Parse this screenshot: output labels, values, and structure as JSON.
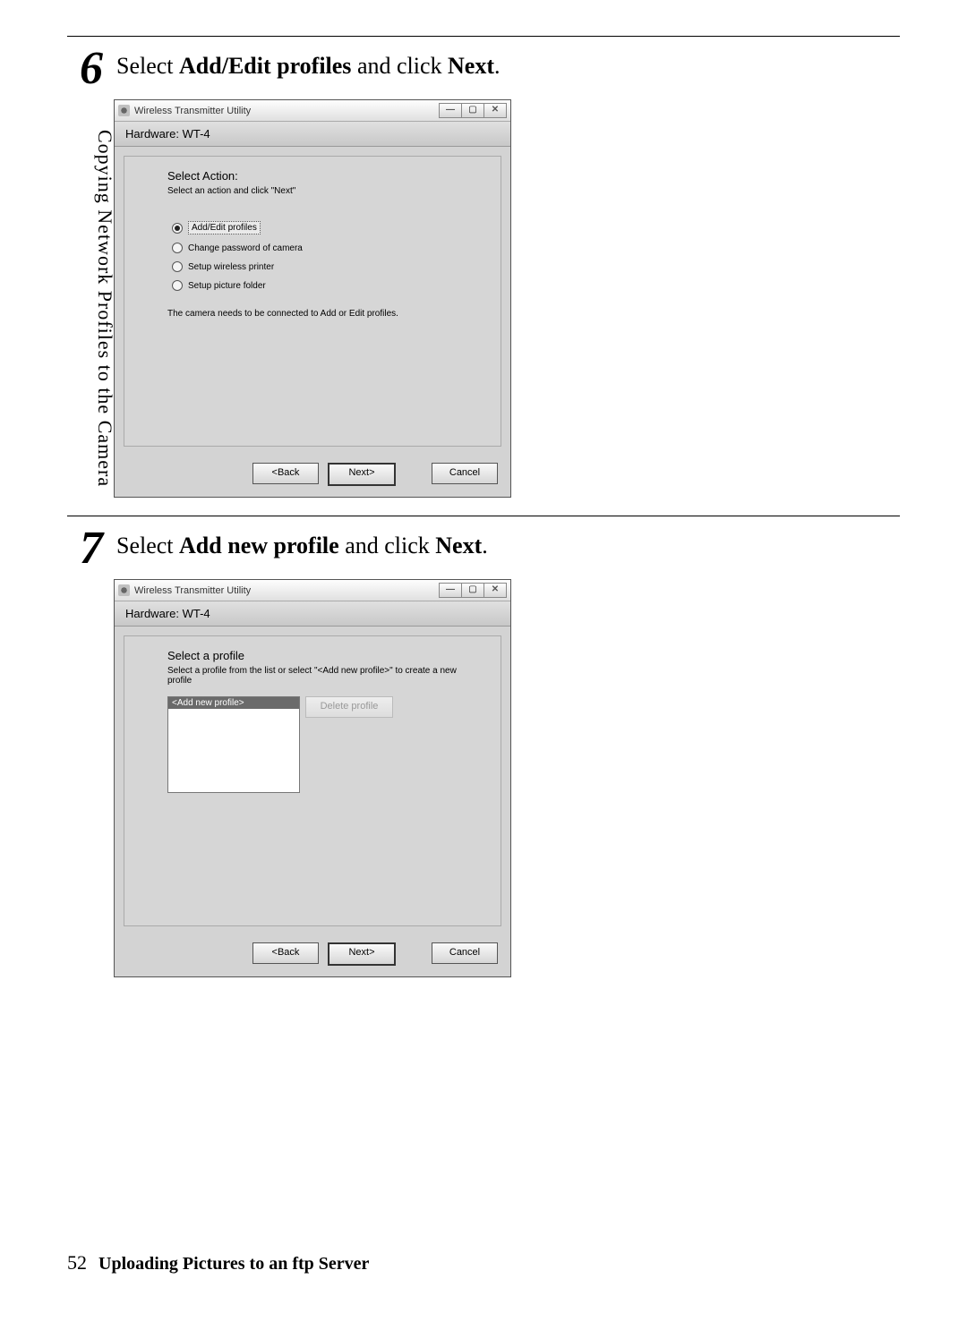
{
  "side_label": "Copying Network Profiles to the Camera",
  "steps": [
    {
      "number": "6",
      "text_prefix": "Select ",
      "text_bold1": "Add/Edit profiles",
      "text_mid": " and click ",
      "text_bold2": "Next",
      "text_suffix": "."
    },
    {
      "number": "7",
      "text_prefix": "Select ",
      "text_bold1": "Add new profile",
      "text_mid": " and click ",
      "text_bold2": "Next",
      "text_suffix": "."
    }
  ],
  "dialog1": {
    "window_title": "Wireless Transmitter Utility",
    "hardware": "Hardware: WT-4",
    "heading": "Select Action:",
    "sub": "Select an action and click \"Next\"",
    "radios": [
      "Add/Edit profiles",
      "Change password of camera",
      "Setup wireless printer",
      "Setup picture folder"
    ],
    "note": "The camera needs to be connected to Add or Edit profiles.",
    "buttons": {
      "back": "<Back",
      "next": "Next>",
      "cancel": "Cancel"
    }
  },
  "dialog2": {
    "window_title": "Wireless Transmitter Utility",
    "hardware": "Hardware: WT-4",
    "heading": "Select a profile",
    "sub": "Select a profile from the list or select \"<Add new profile>\" to create a new profile",
    "list_selected": "<Add new profile>",
    "delete_btn": "Delete profile",
    "buttons": {
      "back": "<Back",
      "next": "Next>",
      "cancel": "Cancel"
    }
  },
  "footer": {
    "page_number": "52",
    "chapter": "Uploading Pictures to an ftp Server"
  }
}
